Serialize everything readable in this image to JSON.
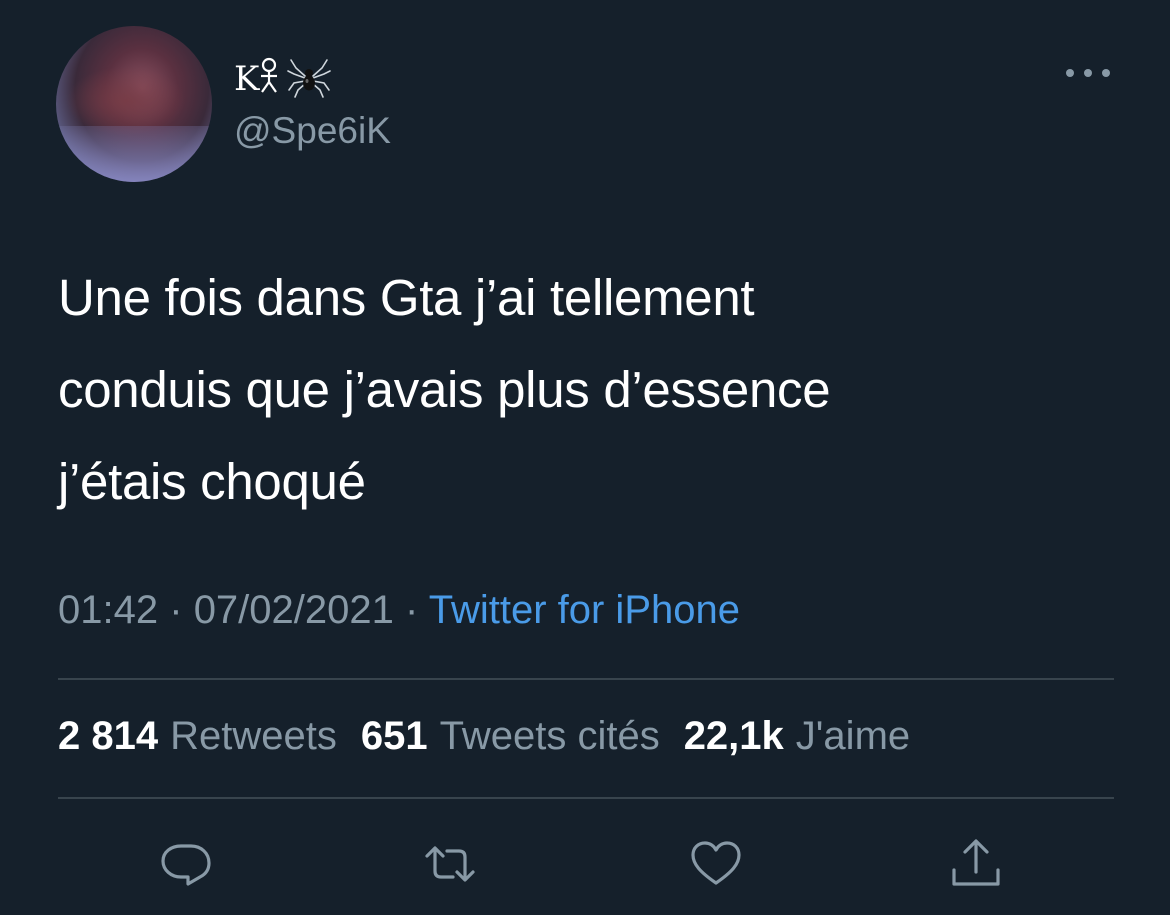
{
  "user": {
    "display_name": "K♀⃠",
    "display_name_text": "K♀",
    "handle": "@Spe6iK",
    "avatar": "profile-photo"
  },
  "tweet": {
    "text": "Une fois dans Gta j’ai tellement\nconduis que j’avais plus d’essence\nj’étais choqué",
    "time": "01:42",
    "separator": "·",
    "date": "07/02/2021",
    "source": "Twitter for iPhone"
  },
  "stats": {
    "retweets_count": "2 814",
    "retweets_label": "Retweets",
    "quotes_count": "651",
    "quotes_label": "Tweets cités",
    "likes_count": "22,1k",
    "likes_label": "J'aime"
  },
  "icons": {
    "more": "more-horizontal-icon",
    "reply": "reply-icon",
    "retweet": "retweet-icon",
    "like": "heart-icon",
    "share": "share-icon",
    "emoji": "spider-icon"
  },
  "colors": {
    "background": "#15202b",
    "text": "#ffffff",
    "secondary": "#8899a6",
    "link": "#4a9be8",
    "divider": "#38444d"
  }
}
